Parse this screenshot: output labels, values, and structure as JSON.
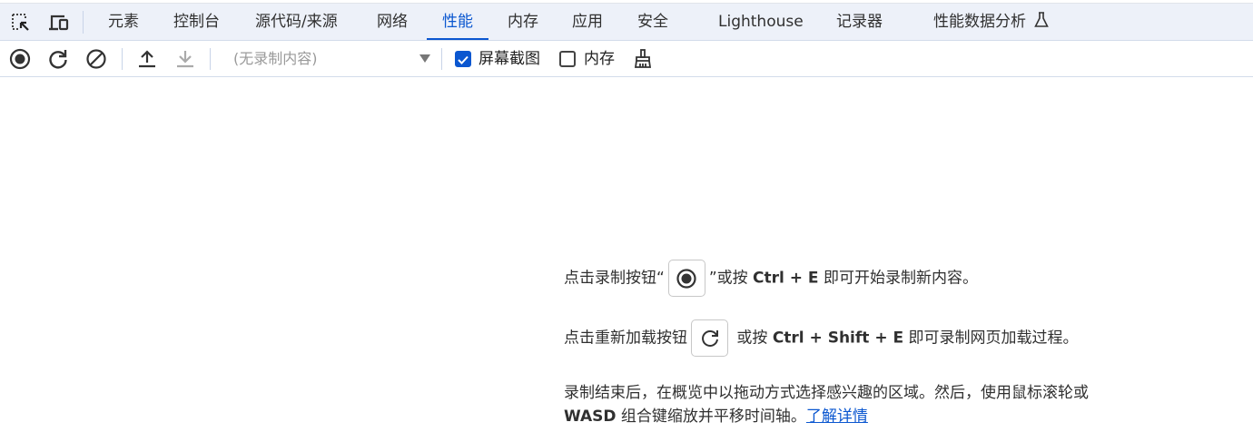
{
  "tabs": [
    {
      "label": "元素"
    },
    {
      "label": "控制台"
    },
    {
      "label": "源代码/来源"
    },
    {
      "label": "网络"
    },
    {
      "label": "性能",
      "active": true
    },
    {
      "label": "内存"
    },
    {
      "label": "应用"
    },
    {
      "label": "安全"
    },
    {
      "label": "Lighthouse"
    },
    {
      "label": "记录器"
    },
    {
      "label": "性能数据分析"
    }
  ],
  "toolbar": {
    "recording_select": "(无录制内容)",
    "screenshots_label": "屏幕截图",
    "screenshots_checked": true,
    "memory_label": "内存",
    "memory_checked": false
  },
  "accent": "#0b57d0",
  "instructions": {
    "line1_a": "点击录制按钮“",
    "line1_b": "”或按",
    "line1_key": "Ctrl + E",
    "line1_c": "即可开始录制新内容。",
    "line2_a": "点击重新加载按钮",
    "line2_b": "或按",
    "line2_key": "Ctrl + Shift + E",
    "line2_c": "即可录制网页加载过程。",
    "line3": "录制结束后，在概览中以拖动方式选择感兴趣的区域。然后，使用鼠标滚轮或",
    "line4_key": "WASD",
    "line4_a": "组合键缩放并平移时间轴。",
    "learn_more": "了解详情"
  }
}
